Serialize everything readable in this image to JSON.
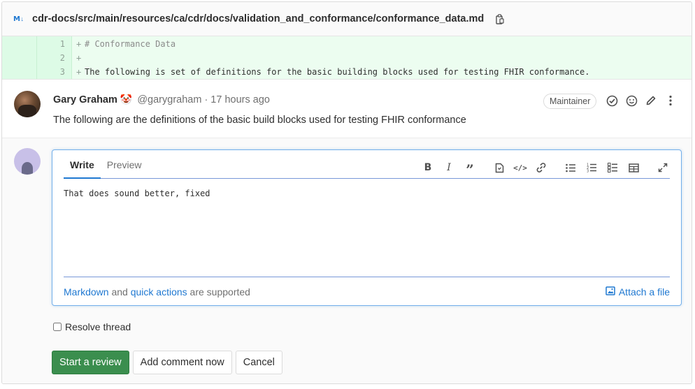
{
  "file": {
    "icon": "markdown-icon",
    "path": "cdr-docs/src/main/resources/ca/cdr/docs/validation_and_conformance/conformance_data.md"
  },
  "diff": {
    "lines": [
      {
        "num": "1",
        "sign": "+",
        "code": "# Conformance Data"
      },
      {
        "num": "2",
        "sign": "+",
        "code": ""
      },
      {
        "num": "3",
        "sign": "+",
        "code": "The following is set of definitions for the basic building blocks used for testing FHIR conformance."
      }
    ]
  },
  "note": {
    "author": "Gary Graham",
    "emoji": "🤡",
    "handle": "@garygraham · 17 hours ago",
    "role": "Maintainer",
    "body": "The following are the definitions of the basic build blocks used for testing FHIR conformance"
  },
  "reply": {
    "tabs": {
      "write": "Write",
      "preview": "Preview"
    },
    "text": "That does sound better, fixed",
    "footer": {
      "markdown": "Markdown",
      "and": " and ",
      "quick_actions": "quick actions",
      "supported": " are supported",
      "attach": "Attach a file"
    },
    "resolve_label": "Resolve thread",
    "buttons": {
      "start_review": "Start a review",
      "add_comment": "Add comment now",
      "cancel": "Cancel"
    }
  },
  "colors": {
    "accent": "#1f78d1",
    "primary_button": "#3b8e4e",
    "diff_added_bg": "#ecfdf0"
  }
}
